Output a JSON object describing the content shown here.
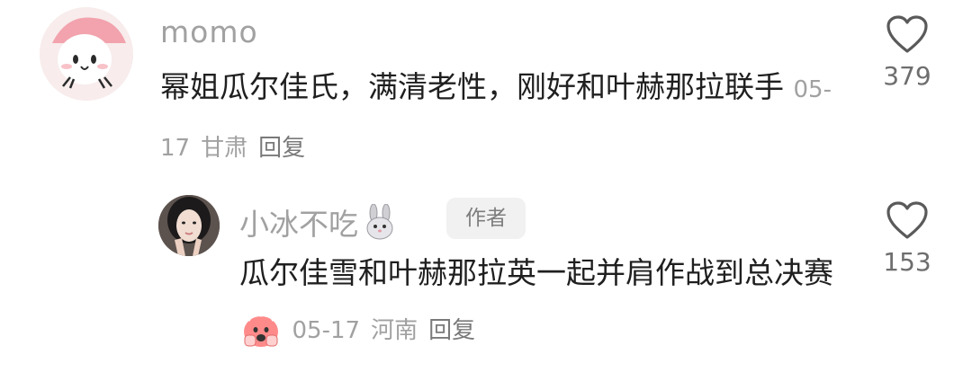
{
  "comments": [
    {
      "username": "momo",
      "text_before": "幂姐瓜尔佳氏，满清老性，刚好和叶赫那拉联手",
      "date": "05-17",
      "location": "甘肃",
      "reply_label": "回复",
      "likes": "379",
      "avatar_icon": "pink-cartoon-avatar-icon"
    }
  ],
  "reply": {
    "username": "小冰不吃",
    "username_emoji": "rabbit-emoji-icon",
    "badge": "作者",
    "text": "瓜尔佳雪和叶赫那拉英一起并肩作战到总决赛",
    "text_emoji": "red-fist-emoji-icon",
    "date": "05-17",
    "location": "河南",
    "reply_label": "回复",
    "likes": "153",
    "avatar_icon": "girl-photo-avatar-icon"
  },
  "colors": {
    "text": "#1f1f1f",
    "meta": "#a1a1a1",
    "badge_bg": "#f1f1f1"
  }
}
